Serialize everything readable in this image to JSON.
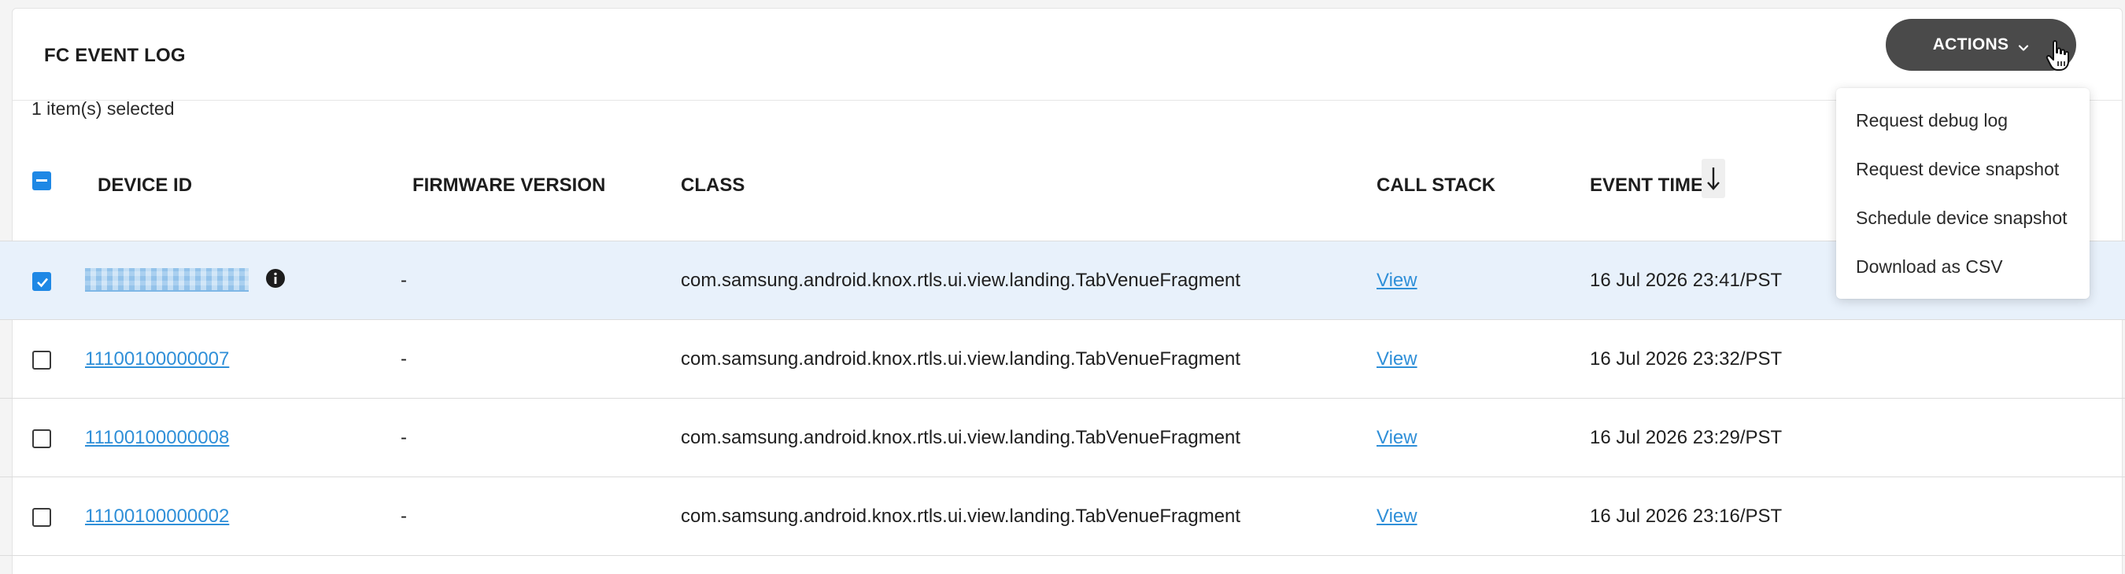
{
  "header": {
    "title": "FC EVENT LOG",
    "actions_label": "ACTIONS"
  },
  "selection": {
    "info": "1 item(s) selected"
  },
  "table": {
    "columns": {
      "device_id": "DEVICE ID",
      "firmware": "FIRMWARE VERSION",
      "class": "CLASS",
      "call_stack": "CALL STACK",
      "event_time": "EVENT TIME"
    },
    "rows": [
      {
        "device_id": "",
        "firmware": "-",
        "class": "com.samsung.android.knox.rtls.ui.view.landing.TabVenueFragment",
        "call_stack": "View",
        "event_time": "16 Jul 2026 23:41/PST"
      },
      {
        "device_id": "11100100000007",
        "firmware": "-",
        "class": "com.samsung.android.knox.rtls.ui.view.landing.TabVenueFragment",
        "call_stack": "View",
        "event_time": "16 Jul 2026 23:32/PST"
      },
      {
        "device_id": "11100100000008",
        "firmware": "-",
        "class": "com.samsung.android.knox.rtls.ui.view.landing.TabVenueFragment",
        "call_stack": "View",
        "event_time": "16 Jul 2026 23:29/PST"
      },
      {
        "device_id": "11100100000002",
        "firmware": "-",
        "class": "com.samsung.android.knox.rtls.ui.view.landing.TabVenueFragment",
        "call_stack": "View",
        "event_time": "16 Jul 2026 23:16/PST"
      }
    ]
  },
  "actions_menu": {
    "items": [
      "Request debug log",
      "Request device snapshot",
      "Schedule device snapshot",
      "Download as CSV"
    ]
  },
  "colors": {
    "accent": "#1e88e5",
    "link": "#2f8fd8",
    "selected_row": "#e8f1fb",
    "actions_button": "#4a4a4a"
  },
  "icons": {
    "actions_chevron": "chevron-down-icon",
    "sort": "arrow-down-icon",
    "info": "info-icon",
    "cursor": "hand-pointer-icon"
  }
}
